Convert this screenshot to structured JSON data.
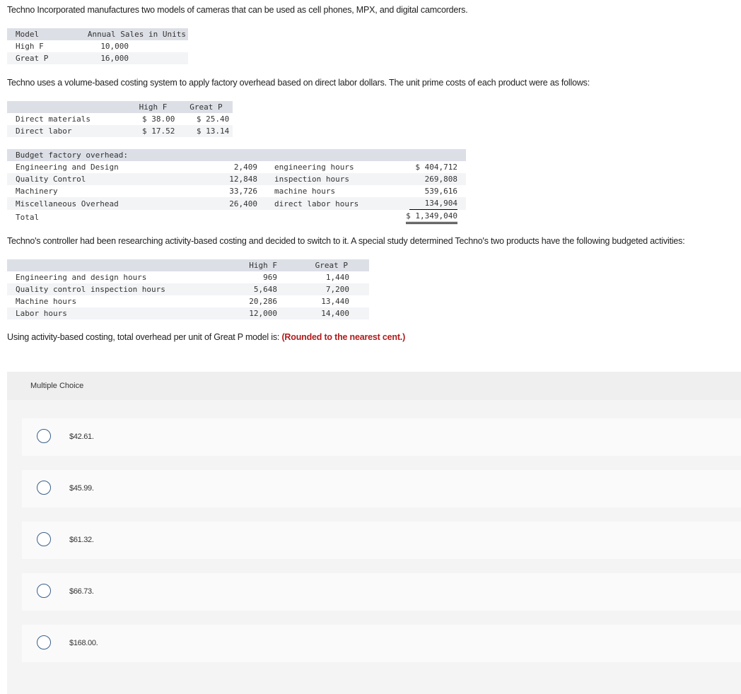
{
  "intro": "Techno Incorporated manufactures two models of cameras that can be used as cell phones, MPX, and digital camcorders.",
  "sales_table": {
    "headers": [
      "Model",
      "Annual Sales in Units"
    ],
    "rows": [
      {
        "model": "High F",
        "units": "10,000"
      },
      {
        "model": "Great P",
        "units": "16,000"
      }
    ]
  },
  "costing_paragraph": "Techno uses a volume-based costing system to apply factory overhead based on direct labor dollars. The unit prime costs of each product were as follows:",
  "prime_costs_table": {
    "headers": [
      "",
      "High F",
      "Great P"
    ],
    "rows": [
      {
        "label": "Direct materials",
        "high_f": "$ 38.00",
        "great_p": "$ 25.40"
      },
      {
        "label": "Direct labor",
        "high_f": "$ 17.52",
        "great_p": "$ 13.14"
      }
    ]
  },
  "overhead_table": {
    "title": "Budget factory overhead:",
    "rows": [
      {
        "label": "Engineering and Design",
        "qty": "2,409",
        "driver": "engineering hours",
        "amount": "$ 404,712"
      },
      {
        "label": "Quality Control",
        "qty": "12,848",
        "driver": "inspection hours",
        "amount": "269,808"
      },
      {
        "label": "Machinery",
        "qty": "33,726",
        "driver": "machine hours",
        "amount": "539,616"
      },
      {
        "label": "Miscellaneous Overhead",
        "qty": "26,400",
        "driver": "direct labor hours",
        "amount": "134,904"
      }
    ],
    "total_label": "Total",
    "total_amount": "$ 1,349,040"
  },
  "abc_paragraph": "Techno's controller had been researching activity-based costing and decided to switch to it. A special study determined Techno's two products have the following budgeted activities:",
  "activities_table": {
    "headers": [
      "",
      "High F",
      "Great P"
    ],
    "rows": [
      {
        "label": "Engineering and design hours",
        "high_f": "969",
        "great_p": "1,440"
      },
      {
        "label": "Quality control inspection hours",
        "high_f": "5,648",
        "great_p": "7,200"
      },
      {
        "label": "Machine hours",
        "high_f": "20,286",
        "great_p": "13,440"
      },
      {
        "label": "Labor hours",
        "high_f": "12,000",
        "great_p": "14,400"
      }
    ]
  },
  "question": {
    "text": "Using activity-based costing, total overhead per unit of Great P model is:",
    "note": "(Rounded to the nearest cent.)"
  },
  "multiple_choice": {
    "heading": "Multiple Choice",
    "options": [
      {
        "label": "$42.61."
      },
      {
        "label": "$45.99."
      },
      {
        "label": "$61.32."
      },
      {
        "label": "$66.73."
      },
      {
        "label": "$168.00."
      }
    ]
  }
}
